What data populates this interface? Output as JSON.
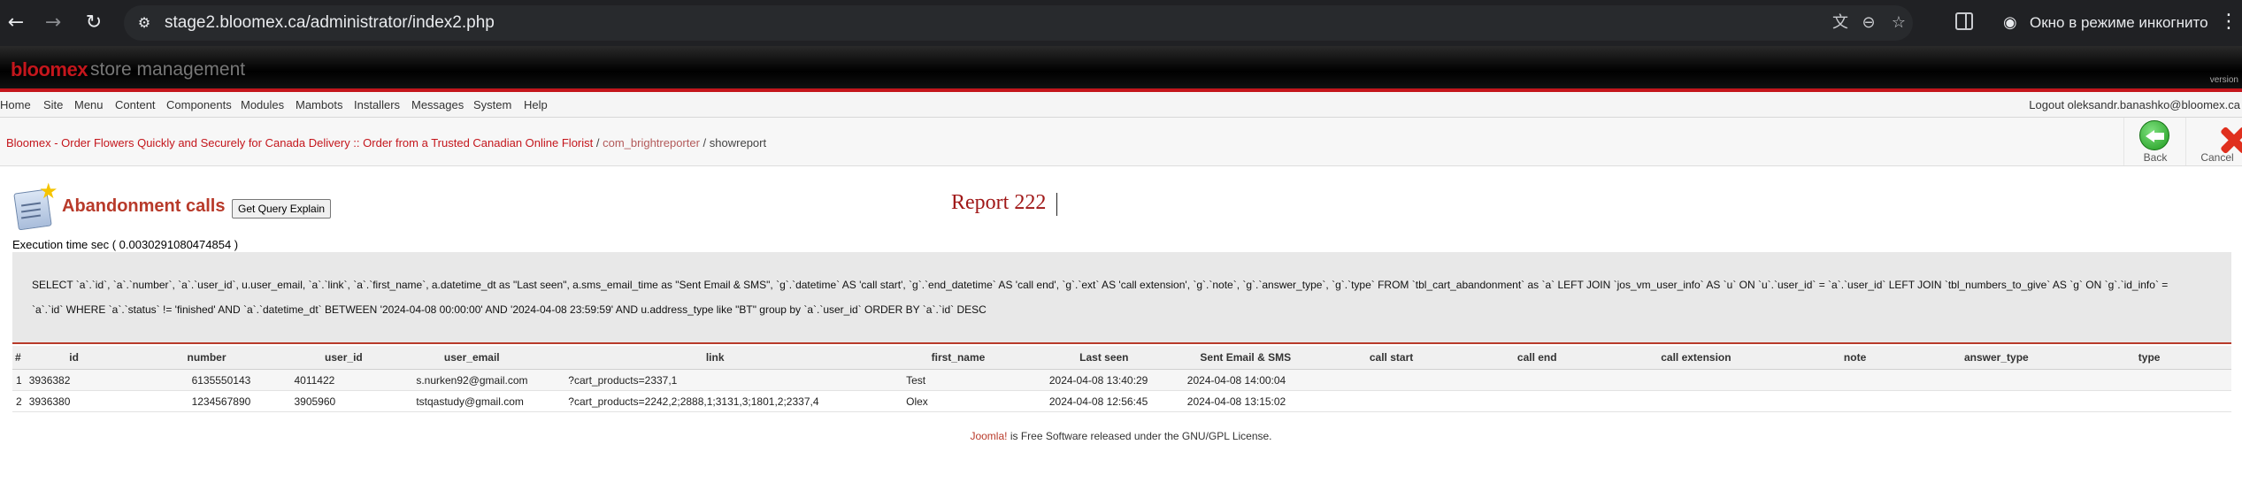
{
  "browser": {
    "url": "stage2.bloomex.ca/administrator/index2.php",
    "incognito_label": "Окно в режиме инкогнито",
    "icons": [
      "back-arrow-icon",
      "forward-arrow-icon",
      "reload-icon",
      "site-settings-icon",
      "translate-icon",
      "zoom-icon",
      "bookmark-star-icon",
      "side-panel-icon",
      "incognito-icon",
      "kebab-menu-icon"
    ]
  },
  "header": {
    "logo": "bloomex",
    "subtitle": "store management",
    "version": "version"
  },
  "menu": {
    "items": [
      "Home",
      "Site",
      "Menu",
      "Content",
      "Components",
      "Modules",
      "Mambots",
      "Installers",
      "Messages",
      "System",
      "Help"
    ],
    "logout": "Logout oleksandr.banashko@bloomex.ca"
  },
  "pathway": {
    "site": "Bloomex - Order Flowers Quickly and Securely for Canada Delivery :: Order from a Trusted Canadian Online Florist",
    "sep1": " / ",
    "component": "com_brightreporter",
    "sep2": " / ",
    "task": "showreport"
  },
  "toolbar": {
    "back": "Back",
    "cancel": "Cancel"
  },
  "page": {
    "title": "Abandonment calls",
    "explain_button": "Get Query Explain",
    "report_name": "Report 222",
    "execution_time": "Execution time sec ( 0.0030291080474854 )",
    "sql": "SELECT `a`.`id`, `a`.`number`, `a`.`user_id`, u.user_email, `a`.`link`, `a`.`first_name`, a.datetime_dt as \"Last seen\", a.sms_email_time as \"Sent Email & SMS\", `g`.`datetime` AS 'call start', `g`.`end_datetime` AS 'call end', `g`.`ext` AS 'call extension', `g`.`note`, `g`.`answer_type`, `g`.`type` FROM `tbl_cart_abandonment` as `a` LEFT JOIN `jos_vm_user_info` AS `u` ON `u`.`user_id` = `a`.`user_id` LEFT JOIN `tbl_numbers_to_give` AS `g` ON `g`.`id_info` = `a`.`id` WHERE `a`.`status` != 'finished' AND `a`.`datetime_dt` BETWEEN '2024-04-08 00:00:00' AND '2024-04-08 23:59:59' AND u.address_type like \"BT\" group by `a`.`user_id` ORDER BY `a`.`id` DESC"
  },
  "table": {
    "columns": [
      "#",
      "id",
      "number",
      "user_id",
      "user_email",
      "link",
      "first_name",
      "Last seen",
      "Sent Email & SMS",
      "call start",
      "call end",
      "call extension",
      "note",
      "answer_type",
      "type"
    ],
    "rows": [
      [
        "1",
        "3936382",
        "6135550143",
        "4011422",
        "s.nurken92@gmail.com",
        "?cart_products=2337,1",
        "Test",
        "2024-04-08 13:40:29",
        "2024-04-08 14:00:04",
        "",
        "",
        "",
        "",
        "",
        ""
      ],
      [
        "2",
        "3936380",
        "1234567890",
        "3905960",
        "tstqastudy@gmail.com",
        "?cart_products=2242,2;2888,1;3131,3;1801,2;2337,4",
        "Olex",
        "2024-04-08 12:56:45",
        "2024-04-08 13:15:02",
        "",
        "",
        "",
        "",
        "",
        ""
      ]
    ]
  },
  "footer": {
    "link": "Joomla!",
    "text": " is Free Software released under the GNU/GPL License."
  }
}
